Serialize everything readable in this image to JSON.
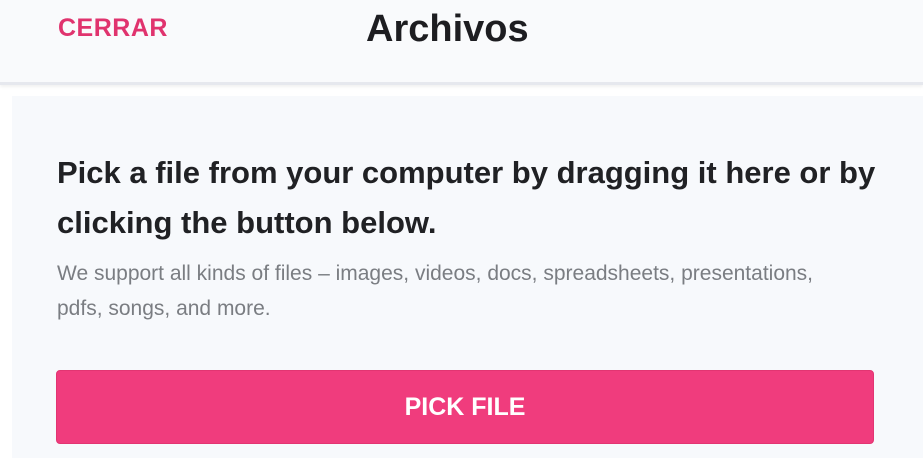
{
  "header": {
    "close_label": "CERRAR",
    "title": "Archivos"
  },
  "picker": {
    "heading": "Pick a file from your computer by dragging it here or by clicking the button below.",
    "description": "We support all kinds of files – images, videos, docs, spreadsheets, presentations, pdfs, songs, and more.",
    "button_label": "PICK FILE"
  },
  "colors": {
    "accent": "#f03c7d",
    "accent_text": "#e0336e"
  }
}
